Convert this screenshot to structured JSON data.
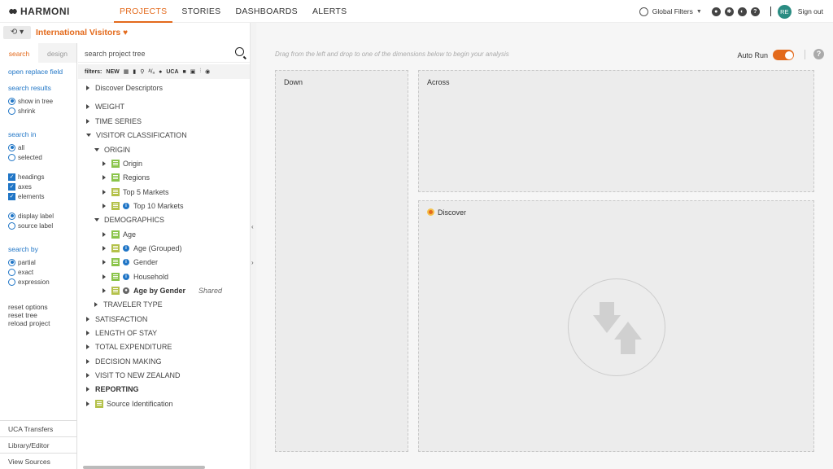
{
  "header": {
    "logo": "HARMONI",
    "nav": [
      {
        "label": "PROJECTS",
        "active": true
      },
      {
        "label": "STORIES",
        "active": false
      },
      {
        "label": "DASHBOARDS",
        "active": false
      },
      {
        "label": "ALERTS",
        "active": false
      }
    ],
    "global_filters": "Global Filters",
    "avatar_initials": "RE",
    "sign_out": "Sign out"
  },
  "project": {
    "history_icon": "history-icon",
    "title": "International Visitors",
    "heart": "♥"
  },
  "options_panel": {
    "tabs": [
      "search",
      "design"
    ],
    "open_replace": "open replace field",
    "search_results": {
      "label": "search results",
      "options": [
        "show in tree",
        "shrink"
      ],
      "selected": 0
    },
    "search_in": {
      "label": "search in",
      "options": [
        "all",
        "selected"
      ],
      "selected": 0
    },
    "checks": [
      "headings",
      "axes",
      "elements"
    ],
    "label_mode": {
      "options": [
        "display label",
        "source label"
      ],
      "selected": 0
    },
    "search_by": {
      "label": "search by",
      "options": [
        "partial",
        "exact",
        "expression"
      ],
      "selected": 0
    },
    "actions": [
      "reset options",
      "reset tree",
      "reload project"
    ],
    "bottom_links": [
      "UCA Transfers",
      "Library/Editor",
      "View Sources"
    ]
  },
  "tree_panel": {
    "search_placeholder": "search project tree",
    "filters_label": "filters:",
    "filter_new": "NEW",
    "filter_uca": "UCA",
    "filter_alpha": "ᴬ/ₐ",
    "nodes": [
      {
        "label": "Discover Descriptors"
      },
      {
        "label": "WEIGHT"
      },
      {
        "label": "TIME SERIES"
      },
      {
        "label": "VISITOR CLASSIFICATION"
      },
      {
        "label": "ORIGIN"
      },
      {
        "label": "Origin"
      },
      {
        "label": "Regions"
      },
      {
        "label": "Top 5 Markets"
      },
      {
        "label": "Top 10 Markets"
      },
      {
        "label": "DEMOGRAPHICS"
      },
      {
        "label": "Age"
      },
      {
        "label": "Age (Grouped)"
      },
      {
        "label": "Gender"
      },
      {
        "label": "Household"
      },
      {
        "label": "Age by Gender",
        "tag": "Shared"
      },
      {
        "label": "TRAVELER TYPE"
      },
      {
        "label": "SATISFACTION"
      },
      {
        "label": "LENGTH OF STAY"
      },
      {
        "label": "TOTAL EXPENDITURE"
      },
      {
        "label": "DECISION MAKING"
      },
      {
        "label": "VISIT TO NEW ZEALAND"
      },
      {
        "label": "REPORTING"
      },
      {
        "label": "Source Identification"
      }
    ]
  },
  "workspace": {
    "hint": "Drag from the left and drop to one of the dimensions below to begin your analysis",
    "auto_run": "Auto Run",
    "auto_run_on": true,
    "help": "?",
    "zones": {
      "down": "Down",
      "across": "Across",
      "discover": "Discover"
    }
  },
  "colors": {
    "accent": "#e36a1c",
    "link": "#1f75c6",
    "avatar": "#2a8c82",
    "variable_icon": "#8ac44a"
  }
}
